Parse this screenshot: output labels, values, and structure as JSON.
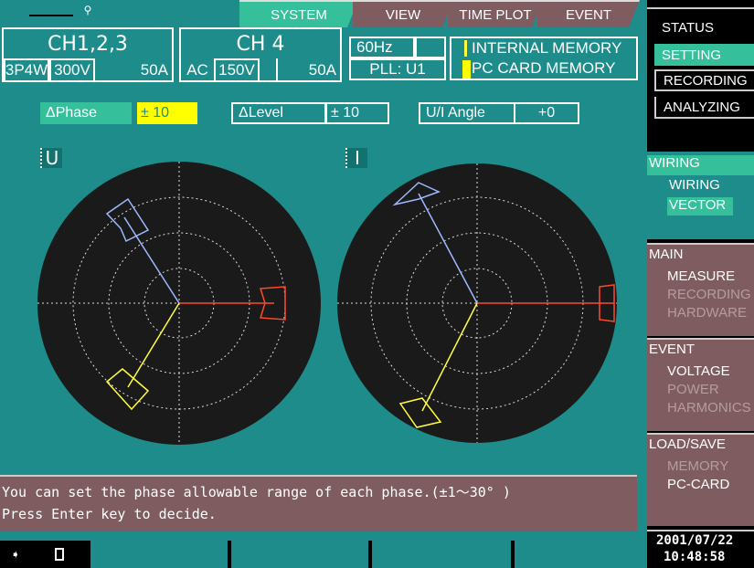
{
  "tabs": [
    {
      "label": "SYSTEM",
      "active": true
    },
    {
      "label": "VIEW",
      "active": false
    },
    {
      "label": "TIME PLOT",
      "active": false
    },
    {
      "label": "EVENT",
      "active": false
    }
  ],
  "channels": {
    "ch123": {
      "title": "CH1,2,3",
      "wiring": "3P4W",
      "voltage": "300V",
      "current": "50A"
    },
    "ch4": {
      "title": "CH 4",
      "mode": "AC",
      "voltage": "150V",
      "current": "50A"
    }
  },
  "freq": "60Hz",
  "pll": "PLL: U1",
  "memory": {
    "internal": "INTERNAL MEMORY",
    "card": "PC CARD MEMORY"
  },
  "params": {
    "dphase_label": "ΔPhase",
    "dphase_value": "± 10",
    "dlevel_label": "ΔLevel",
    "dlevel_value": "± 10",
    "ui_label": "U/I Angle",
    "ui_value": "+0"
  },
  "vectors": {
    "u_label": "U",
    "i_label": "I"
  },
  "message": {
    "line1": "You can set the phase allowable range of each phase.(±1～30° )",
    "line2": "Press Enter key to decide."
  },
  "right_panel": {
    "status_items": [
      "STATUS",
      "SETTING",
      "RECORDING",
      "ANALYZING"
    ],
    "wiring_head": "WIRING",
    "wiring_items": [
      "WIRING",
      "VECTOR"
    ],
    "main_head": "MAIN",
    "main_items": [
      "MEASURE",
      "RECORDING",
      "HARDWARE"
    ],
    "event_head": "EVENT",
    "event_items": [
      "VOLTAGE",
      "POWER",
      "HARMONICS"
    ],
    "load_head": "LOAD/SAVE",
    "load_items": [
      "MEMORY",
      "PC-CARD"
    ],
    "date": "2001/07/22",
    "time": "10:48:58"
  },
  "colors": {
    "bg": "#1d8c8a",
    "accent": "#35c09b",
    "panel": "#7f5c5f",
    "phase1": "#9fb8ff",
    "phase2": "#ffff3a",
    "phase3": "#ff4a2a",
    "highlight": "#ffff00"
  }
}
